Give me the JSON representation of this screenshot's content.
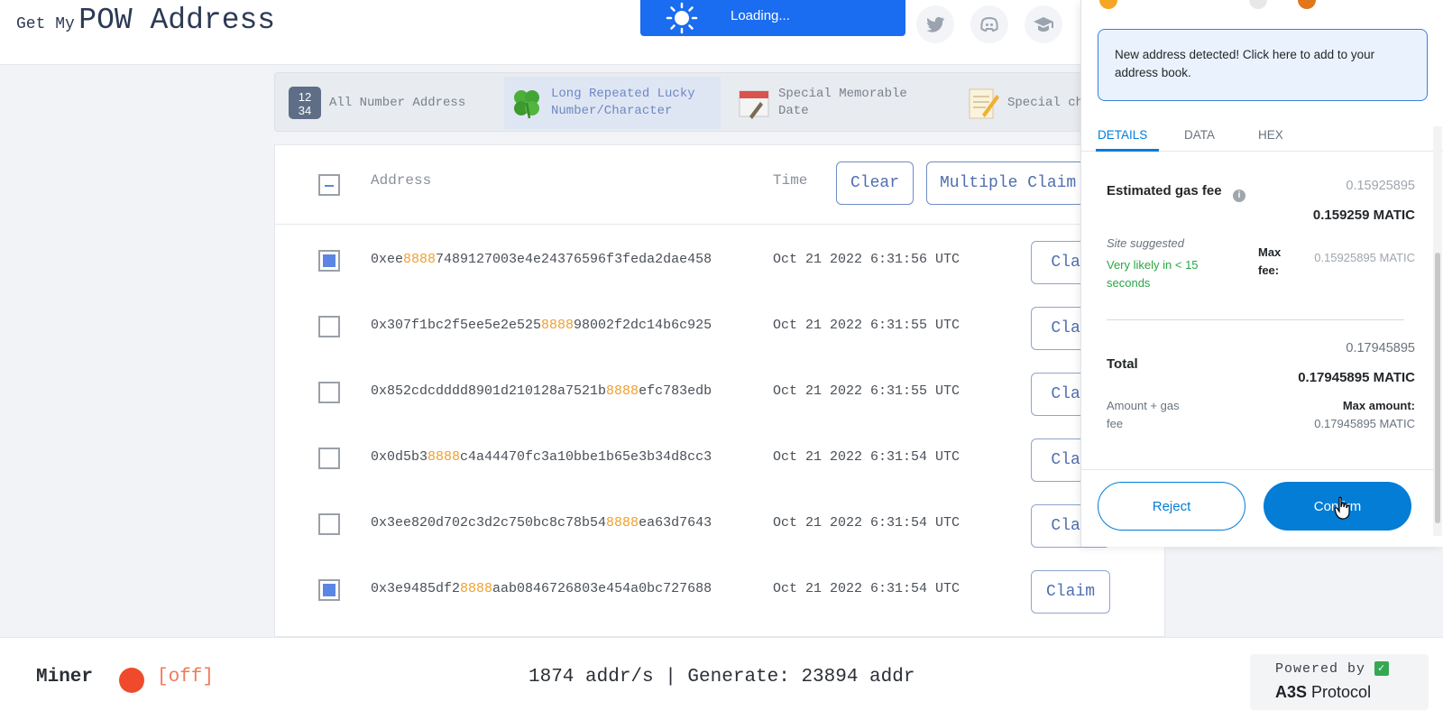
{
  "header": {
    "logo_small": "Get My",
    "logo_big": "POW Address",
    "loading_text": "Loading..."
  },
  "categories": [
    {
      "label_line1": "All Number Address",
      "label_line2": "",
      "icon": "number-tile-icon",
      "active": false
    },
    {
      "label_line1": "Long Repeated Lucky",
      "label_line2": "Number/Character",
      "icon": "clover-icon",
      "active": true
    },
    {
      "label_line1": "Special Memorable",
      "label_line2": "Date",
      "icon": "calendar-icon",
      "active": false
    },
    {
      "label_line1": "Special ch",
      "label_line2": "",
      "icon": "memo-icon",
      "active": false
    }
  ],
  "table": {
    "col_address": "Address",
    "col_time": "Time",
    "clear_label": "Clear",
    "multiple_claim_label": "Multiple Claim",
    "claim_label": "Claim",
    "claim_label_cut": "Clai",
    "rows": [
      {
        "pre": "0xee",
        "hl": "8888",
        "post": "7489127003e4e24376596f3feda2dae458",
        "time": "Oct 21 2022 6:31:56 UTC",
        "checked": true
      },
      {
        "pre": "0x307f1bc2f5ee5e2e525",
        "hl": "8888",
        "post": "98002f2dc14b6c925",
        "time": "Oct 21 2022 6:31:55 UTC",
        "checked": false
      },
      {
        "pre": "0x852cdcdddd8901d210128a7521b",
        "hl": "8888",
        "post": "efc783edb",
        "time": "Oct 21 2022 6:31:55 UTC",
        "checked": false
      },
      {
        "pre": "0x0d5b3",
        "hl": "8888",
        "post": "c4a44470fc3a10bbe1b65e3b34d8cc3",
        "time": "Oct 21 2022 6:31:54 UTC",
        "checked": false
      },
      {
        "pre": "0x3ee820d702c3d2c750bc8c78b54",
        "hl": "8888",
        "post": "ea63d7643",
        "time": "Oct 21 2022 6:31:54 UTC",
        "checked": false
      },
      {
        "pre": "0x3e9485df2",
        "hl": "8888",
        "post": "aab0846726803e454a0bc727688",
        "time": "Oct 21 2022 6:31:54 UTC",
        "checked": true
      }
    ]
  },
  "footer": {
    "miner_label": "Miner",
    "miner_state": "[off]",
    "stats": "1874 addr/s | Generate: 23894 addr",
    "powered_by": "Powered by",
    "protocol_logo": "A3S",
    "protocol_name": "Protocol"
  },
  "wallet": {
    "notice": "New address detected! Click here to add to your address book.",
    "tabs": [
      "DETAILS",
      "DATA",
      "HEX"
    ],
    "gas_label": "Estimated gas fee",
    "gas_value_grey": "0.15925895",
    "gas_value_bold": "0.159259 MATIC",
    "site_suggested": "Site suggested",
    "likely": "Very likely in < 15 seconds",
    "max_fee_label": "Max fee:",
    "max_fee_value": "0.15925895 MATIC",
    "total_label": "Total",
    "total_grey": "0.17945895",
    "total_bold": "0.17945895 MATIC",
    "amount_gas": "Amount + gas fee",
    "max_amount_label": "Max amount:",
    "max_amount_value": "0.17945895 MATIC",
    "reject_label": "Reject",
    "confirm_label": "Confirm"
  },
  "colors": {
    "accent_blue": "#037dd6",
    "highlight_orange": "#f0a030",
    "miner_red": "#f04a2c"
  }
}
